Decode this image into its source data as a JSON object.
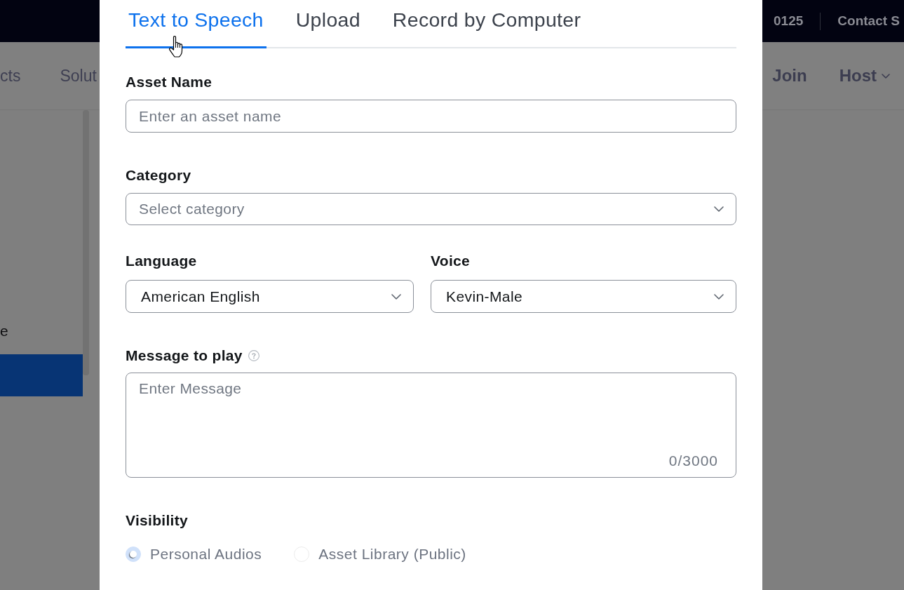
{
  "background_page": {
    "top_bar": {
      "items": [
        "0125",
        "Contact S"
      ]
    },
    "nav_left": [
      {
        "label": "cts"
      },
      {
        "label": "Solut"
      }
    ],
    "nav_right": [
      {
        "label": "Join",
        "kind": "link"
      },
      {
        "label": "Host",
        "kind": "dropdown"
      }
    ],
    "sidebar": {
      "items": [
        {
          "label": "e",
          "selected": false
        },
        {
          "selected": true
        }
      ]
    }
  },
  "dialog": {
    "tabs": [
      {
        "label": "Text to Speech",
        "selected": true
      },
      {
        "label": "Upload",
        "selected": false
      },
      {
        "label": "Record by Computer",
        "selected": false
      }
    ],
    "fields": [
      {
        "kind": "text",
        "label": "Asset Name",
        "placeholder": "Enter an asset name"
      },
      {
        "kind": "select",
        "label": "Category",
        "placeholder": "Select category"
      },
      {
        "kind": "row",
        "fields": [
          {
            "kind": "select",
            "label": "Language",
            "value": "American English"
          },
          {
            "kind": "select",
            "label": "Voice",
            "value": "Kevin-Male"
          }
        ]
      },
      {
        "kind": "textarea",
        "label": "Message to play",
        "help": true,
        "placeholder": "Enter Message",
        "counter": "0/3000"
      },
      {
        "kind": "radio",
        "label": "Visibility",
        "options": [
          {
            "label": "Personal Audios",
            "selected": true
          },
          {
            "label": "Asset Library (Public)",
            "selected": false
          }
        ]
      }
    ]
  }
}
